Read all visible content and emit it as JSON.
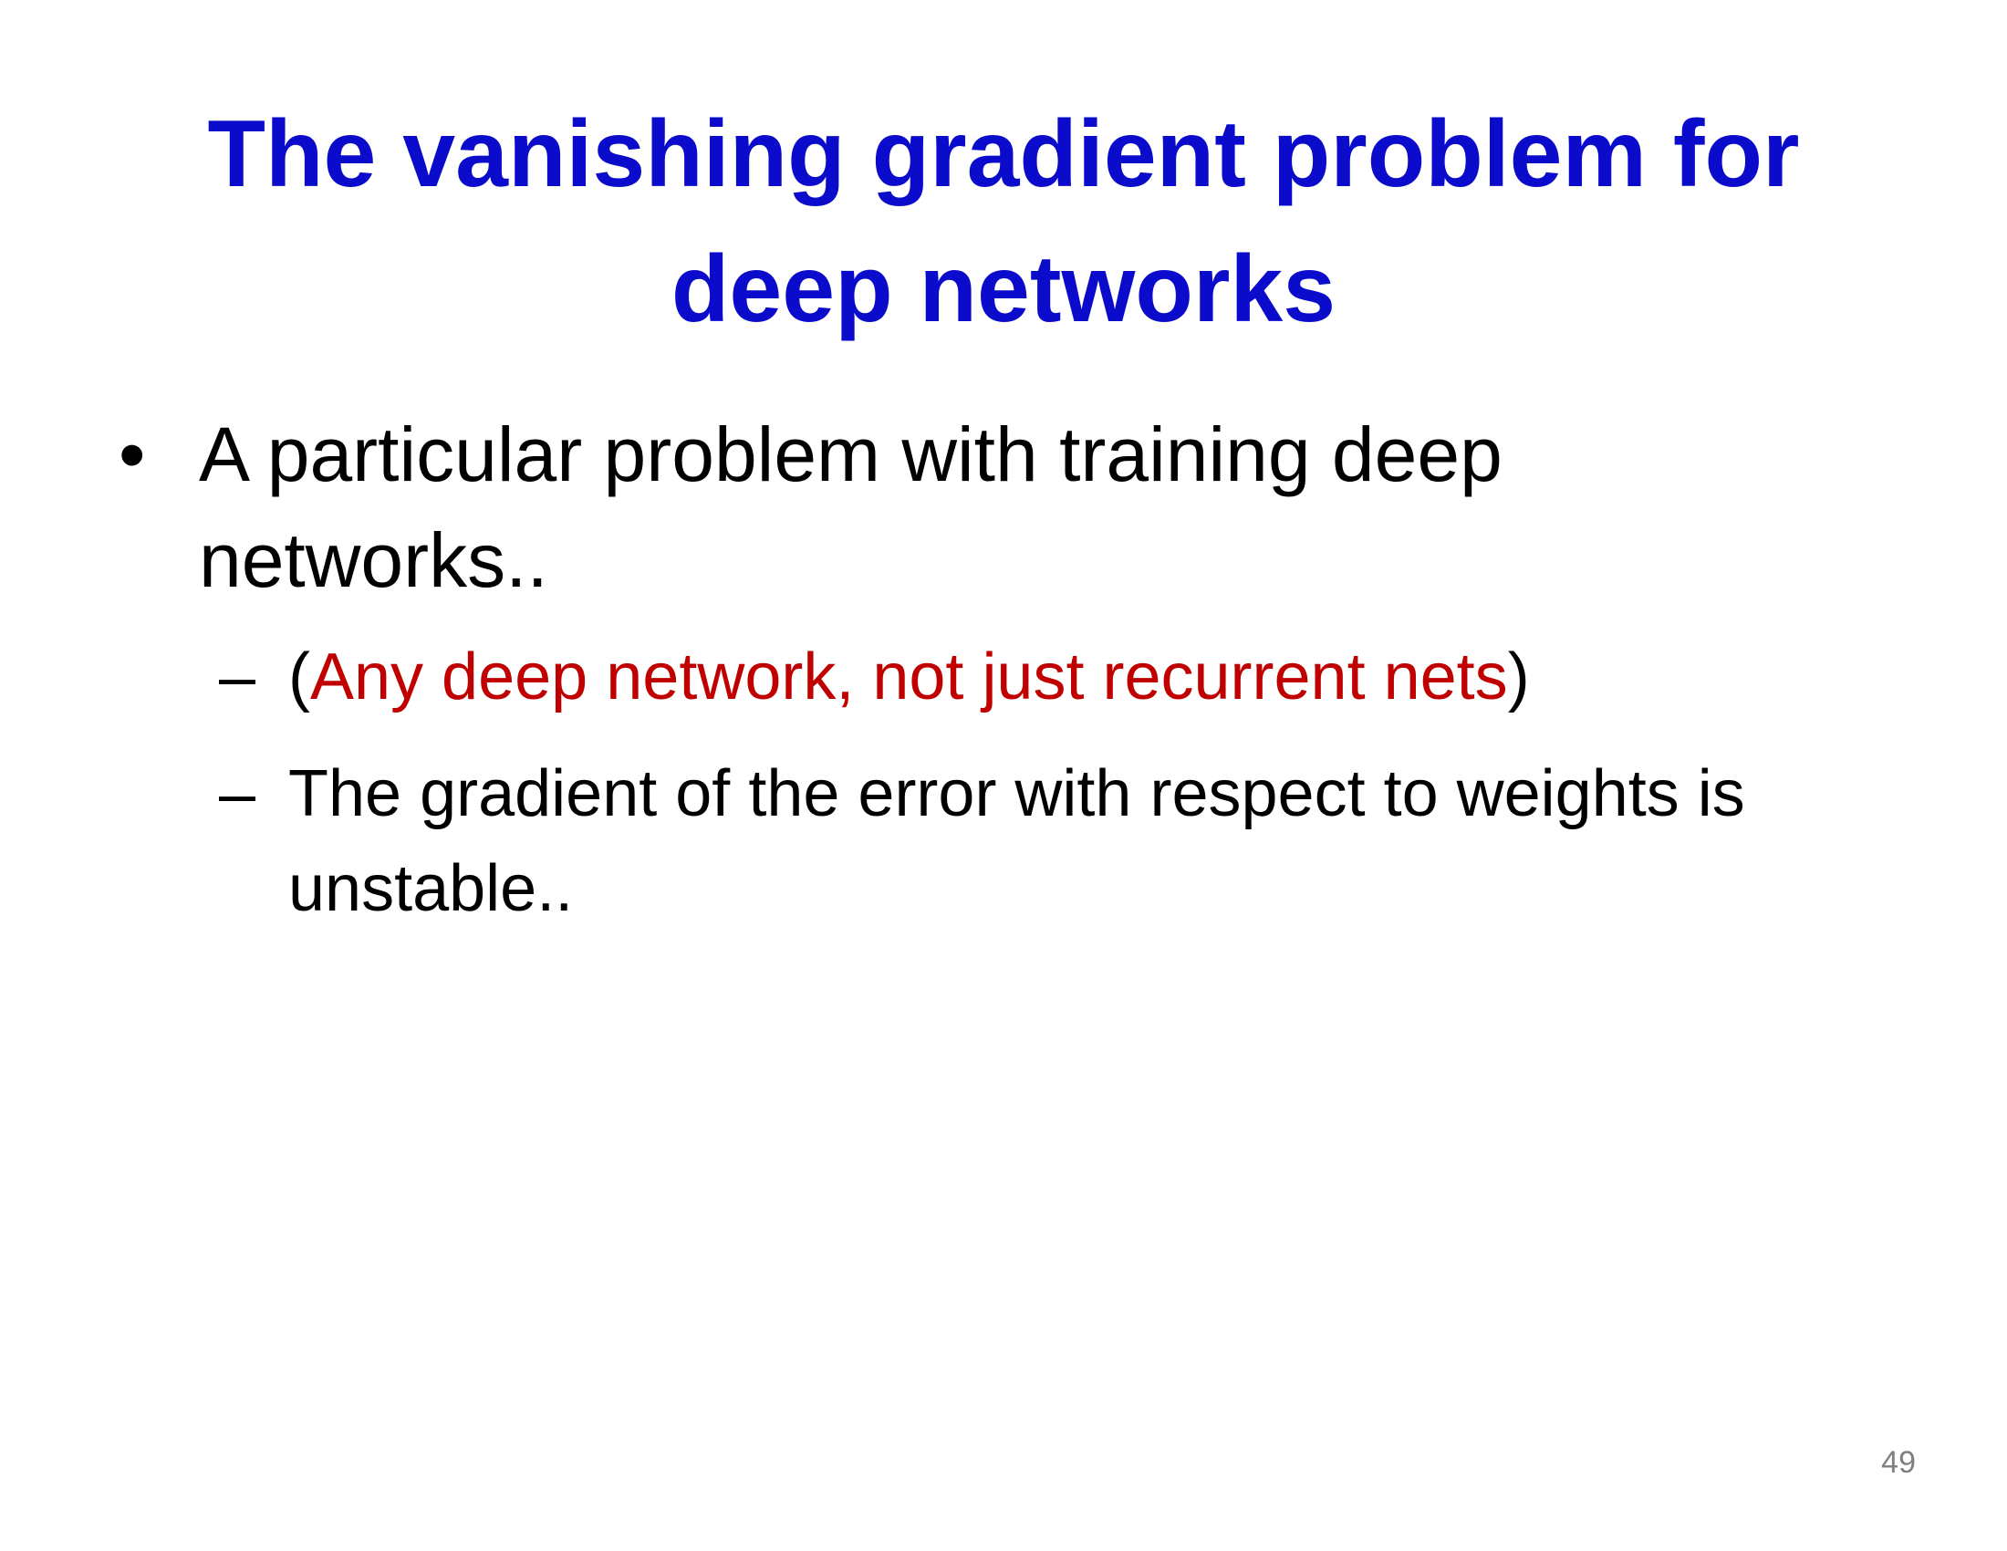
{
  "slide": {
    "title": "The vanishing gradient problem for deep networks",
    "bullets": [
      {
        "marker": "•",
        "text": "A particular problem with training deep networks..",
        "sub_bullets": [
          {
            "marker": "–",
            "open_paren": "(",
            "highlight": "Any deep network, not just recurrent nets",
            "close_paren": ")"
          },
          {
            "marker": "–",
            "text": "The gradient of the error with respect to weights is unstable.."
          }
        ]
      }
    ],
    "page_number": "49"
  },
  "colors": {
    "title": "#0b0bcc",
    "body_text": "#000000",
    "highlight": "#c00000",
    "page_number": "#7f7f7f",
    "background": "#ffffff"
  }
}
